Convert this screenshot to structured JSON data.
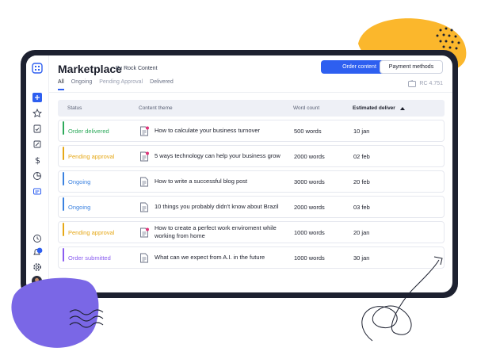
{
  "app": {
    "title": "Marketplace",
    "subtitle": "By Rock Content"
  },
  "buttons": {
    "order": "Order content",
    "payment": "Payment methods"
  },
  "tabs": [
    {
      "label": "All",
      "active": true
    },
    {
      "label": "Ongoing",
      "active": false
    },
    {
      "label": "Pending Approval",
      "active": false
    },
    {
      "label": "Delivered",
      "active": false
    }
  ],
  "credits": "RC 4.751",
  "table": {
    "headers": {
      "status": "Status",
      "theme": "Content theme",
      "words": "Word count",
      "date": "Estimated deliver"
    },
    "rows": [
      {
        "status": "Order delivered",
        "status_color": "#2eaa5c",
        "theme": "How to calculate your business turnover",
        "words": "500 words",
        "date": "10 jan",
        "notify": true
      },
      {
        "status": "Pending approval",
        "status_color": "#e6a817",
        "theme": "5 ways technology can help your business grow",
        "words": "2000 words",
        "date": "02 feb",
        "notify": true
      },
      {
        "status": "Ongoing",
        "status_color": "#3b82e0",
        "theme": "How to write a successful blog post",
        "words": "3000 words",
        "date": "20 feb",
        "notify": false
      },
      {
        "status": "Ongoing",
        "status_color": "#3b82e0",
        "theme": "10 things you probably didn't know about Brazil",
        "words": "2000 words",
        "date": "03 feb",
        "notify": false
      },
      {
        "status": "Pending approval",
        "status_color": "#e6a817",
        "theme": "How to create a perfect work enviroment while working from home",
        "words": "1000 words",
        "date": "20 jan",
        "notify": true
      },
      {
        "status": "Order submitted",
        "status_color": "#8a5cf0",
        "theme": "What can we expect from A.I. in the future",
        "words": "1000 words",
        "date": "30 jan",
        "notify": false
      }
    ]
  },
  "sidebar": {
    "top_icons": [
      "app-logo-icon",
      "add-icon",
      "star-icon",
      "clipboard-check-icon",
      "edit-icon",
      "dollar-icon",
      "pie-chart-icon",
      "message-icon"
    ],
    "bottom_icons": [
      "clock-icon",
      "notification-icon",
      "settings-icon",
      "avatar"
    ],
    "notification_count": "2"
  },
  "colors": {
    "accent": "#2e5ff0",
    "device": "#1d2130",
    "blob_yellow": "#fbb72c",
    "blob_purple": "#7a67e6",
    "notify_dot": "#e0357a"
  }
}
